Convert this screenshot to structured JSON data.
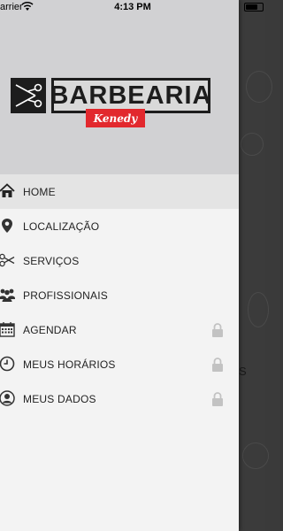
{
  "status_bar": {
    "carrier": "arrier",
    "time": "4:13 PM"
  },
  "brand": {
    "name": "BARBEARIA",
    "subtitle": "Kenedy",
    "accent_color": "#e2282d"
  },
  "menu": {
    "items": [
      {
        "label": "HOME",
        "icon": "home-icon",
        "locked": false,
        "active": true
      },
      {
        "label": "LOCALIZAÇÃO",
        "icon": "location-pin-icon",
        "locked": false,
        "active": false
      },
      {
        "label": "SERVIÇOS",
        "icon": "scissors-icon",
        "locked": false,
        "active": false
      },
      {
        "label": "PROFISSIONAIS",
        "icon": "people-icon",
        "locked": false,
        "active": false
      },
      {
        "label": "AGENDAR",
        "icon": "calendar-icon",
        "locked": true,
        "active": false
      },
      {
        "label": "MEUS HORÁRIOS",
        "icon": "clock-icon",
        "locked": true,
        "active": false
      },
      {
        "label": "MEUS DADOS",
        "icon": "user-icon",
        "locked": true,
        "active": false
      }
    ]
  },
  "background_fragment": "S"
}
